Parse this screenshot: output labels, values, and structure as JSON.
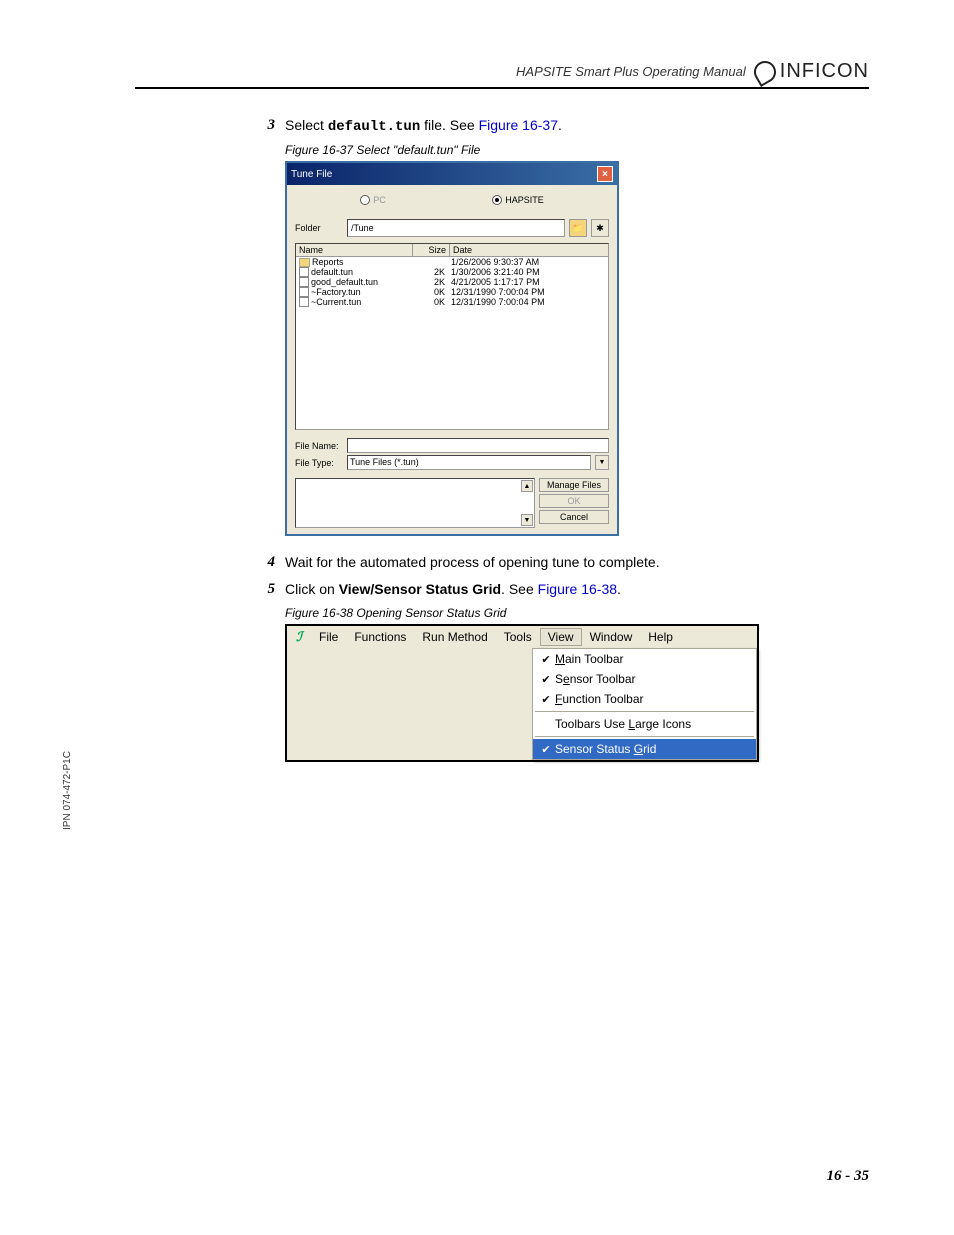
{
  "header": {
    "manual_title": "HAPSITE Smart Plus Operating Manual",
    "brand": "INFICON"
  },
  "steps": {
    "s3": {
      "num": "3",
      "pre": "Select ",
      "mono": "default.tun",
      "mid": " file. See ",
      "link": "Figure 16-37",
      "post": "."
    },
    "s4": {
      "num": "4",
      "text": "Wait for the automated process of opening tune to complete."
    },
    "s5": {
      "num": "5",
      "pre": "Click on ",
      "bold": "View/Sensor Status Grid",
      "mid": ". See ",
      "link": "Figure 16-38",
      "post": "."
    }
  },
  "captions": {
    "fig37": "Figure 16-37  Select \"default.tun\" File",
    "fig38": "Figure 16-38  Opening Sensor Status Grid"
  },
  "dialog": {
    "title": "Tune File",
    "radio_pc": "PC",
    "radio_hapsite": "HAPSITE",
    "folder_label": "Folder",
    "folder_value": "/Tune",
    "headers": {
      "name": "Name",
      "size": "Size",
      "date": "Date"
    },
    "rows": [
      {
        "type": "folder",
        "name": "Reports",
        "size": "",
        "date": "1/26/2006 9:30:37 AM"
      },
      {
        "type": "file",
        "name": "default.tun",
        "size": "2K",
        "date": "1/30/2006 3:21:40 PM"
      },
      {
        "type": "file",
        "name": "good_default.tun",
        "size": "2K",
        "date": "4/21/2005 1:17:17 PM"
      },
      {
        "type": "file",
        "name": "~Factory.tun",
        "size": "0K",
        "date": "12/31/1990 7:00:04 PM"
      },
      {
        "type": "file",
        "name": "~Current.tun",
        "size": "0K",
        "date": "12/31/1990 7:00:04 PM"
      }
    ],
    "filename_label": "File Name:",
    "filename_value": "",
    "filetype_label": "File Type:",
    "filetype_value": "Tune Files (*.tun)",
    "btn_manage": "Manage Files",
    "btn_ok": "OK",
    "btn_cancel": "Cancel"
  },
  "menubar": {
    "items": [
      "File",
      "Functions",
      "Run Method",
      "Tools",
      "View",
      "Window",
      "Help"
    ],
    "dropdown": {
      "main_toolbar": "Main Toolbar",
      "sensor_toolbar": "Sensor Toolbar",
      "function_toolbar": "Function Toolbar",
      "large_icons": "Toolbars Use Large Icons",
      "sensor_grid": "Sensor Status Grid"
    }
  },
  "side_label": "IPN 074-472-P1C",
  "page_number": "16 - 35"
}
